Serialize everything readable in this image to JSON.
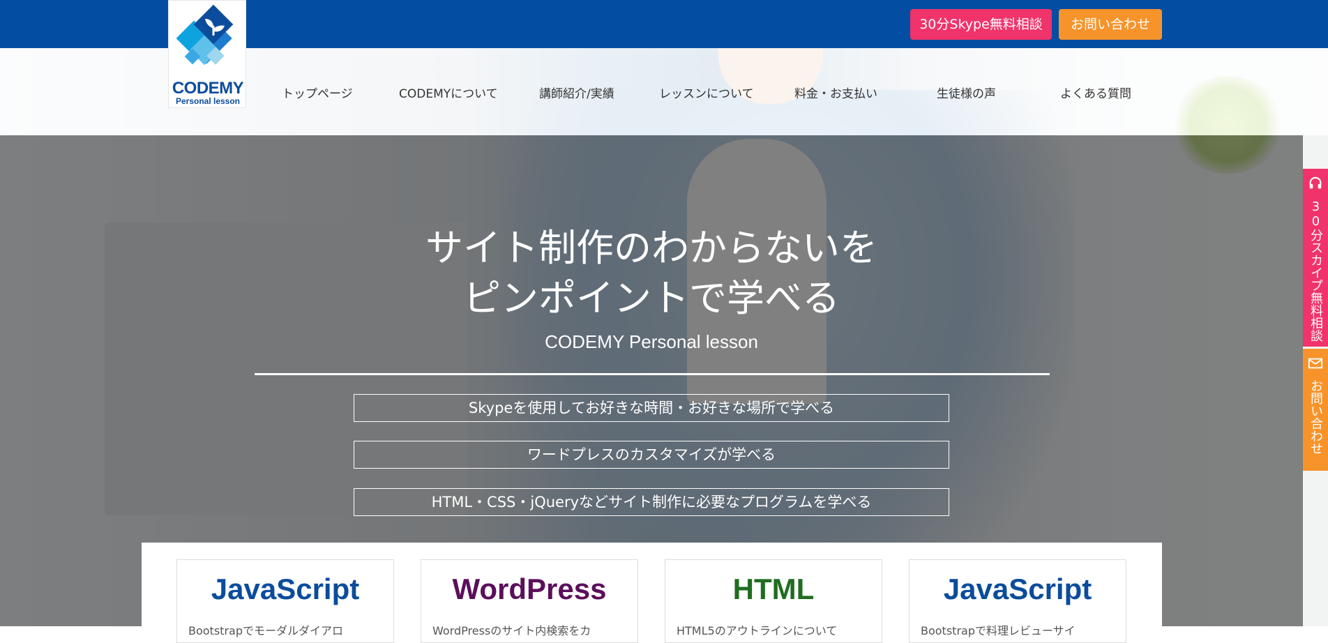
{
  "header": {
    "top_buttons": {
      "skype": "30分Skype無料相談",
      "contact": "お問い合わせ"
    },
    "logo": {
      "name": "CODEMY",
      "sub": "Personal lesson"
    },
    "nav": [
      "トップページ",
      "CODEMYについて",
      "講師紹介/実績",
      "レッスンについて",
      "料金・お支払い",
      "生徒様の声",
      "よくある質問"
    ]
  },
  "hero": {
    "title_line1": "サイト制作のわからないを",
    "title_line2": "ピンポイントで学べる",
    "subtitle": "CODEMY Personal lesson",
    "features": [
      "Skypeを使用してお好きな時間・お好きな場所で学べる",
      "ワードプレスのカスタマイズが学べる",
      "HTML・CSS・jQueryなどサイト制作に必要なプログラムを学べる"
    ]
  },
  "cards": [
    {
      "title": "JavaScript",
      "text": "Bootstrapでモーダルダイアロ",
      "color": "#0b4c9c"
    },
    {
      "title": "WordPress",
      "text": "WordPressのサイト内検索をカ",
      "color": "#5b0f5a"
    },
    {
      "title": "HTML",
      "text": "HTML5のアウトラインについて",
      "color": "#1f6d1f"
    },
    {
      "title": "JavaScript",
      "text": "Bootstrapで料理レビューサイ",
      "color": "#0b4c9c"
    }
  ],
  "side_tabs": {
    "skype": "30分スカイプ無料相談",
    "contact": "お問い合わせ"
  },
  "colors": {
    "topbar": "#034ea2",
    "pink": "#f0336b",
    "orange": "#f7932b"
  }
}
